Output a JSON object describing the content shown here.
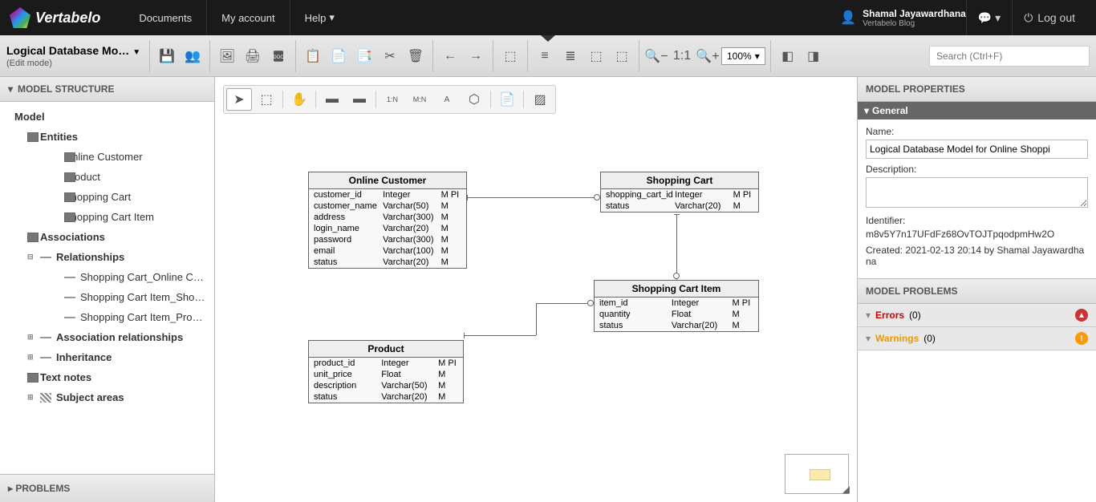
{
  "nav": {
    "brand": "Vertabelo",
    "links": [
      "Documents",
      "My account",
      "Help"
    ],
    "user": {
      "name": "Shamal Jayawardhana",
      "sub": "Vertabelo Blog"
    },
    "logout": "Log out"
  },
  "titlebar": {
    "title": "Logical Database Mo…",
    "mode": "(Edit mode)",
    "zoom": "100%",
    "search_placeholder": "Search (Ctrl+F)"
  },
  "left_panel": {
    "header": "MODEL STRUCTURE",
    "root": "Model",
    "entities_label": "Entities",
    "entities": [
      "Online Customer",
      "Product",
      "Shopping Cart",
      "Shopping Cart Item"
    ],
    "associations_label": "Associations",
    "relationships_label": "Relationships",
    "relationships": [
      "Shopping Cart_Online C…",
      "Shopping Cart Item_Sho…",
      "Shopping Cart Item_Pro…"
    ],
    "assoc_rel_label": "Association relationships",
    "inheritance_label": "Inheritance",
    "textnotes_label": "Text notes",
    "subjectareas_label": "Subject areas",
    "problems_header": "PROBLEMS"
  },
  "entities": {
    "online_customer": {
      "title": "Online Customer",
      "rows": [
        {
          "name": "customer_id",
          "type": "Integer",
          "flags": "M PI"
        },
        {
          "name": "customer_name",
          "type": "Varchar(50)",
          "flags": "M"
        },
        {
          "name": "address",
          "type": "Varchar(300)",
          "flags": "M"
        },
        {
          "name": "login_name",
          "type": "Varchar(20)",
          "flags": "M"
        },
        {
          "name": "password",
          "type": "Varchar(300)",
          "flags": "M"
        },
        {
          "name": "email",
          "type": "Varchar(100)",
          "flags": "M"
        },
        {
          "name": "status",
          "type": "Varchar(20)",
          "flags": "M"
        }
      ]
    },
    "shopping_cart": {
      "title": "Shopping Cart",
      "rows": [
        {
          "name": "shopping_cart_id",
          "type": "Integer",
          "flags": "M PI"
        },
        {
          "name": "status",
          "type": "Varchar(20)",
          "flags": "M"
        }
      ]
    },
    "shopping_cart_item": {
      "title": "Shopping Cart Item",
      "rows": [
        {
          "name": "item_id",
          "type": "Integer",
          "flags": "M PI"
        },
        {
          "name": "quantity",
          "type": "Float",
          "flags": "M"
        },
        {
          "name": "status",
          "type": "Varchar(20)",
          "flags": "M"
        }
      ]
    },
    "product": {
      "title": "Product",
      "rows": [
        {
          "name": "product_id",
          "type": "Integer",
          "flags": "M PI"
        },
        {
          "name": "unit_price",
          "type": "Float",
          "flags": "M"
        },
        {
          "name": "description",
          "type": "Varchar(50)",
          "flags": "M"
        },
        {
          "name": "status",
          "type": "Varchar(20)",
          "flags": "M"
        }
      ]
    }
  },
  "right_panel": {
    "header": "MODEL PROPERTIES",
    "general": "General",
    "name_label": "Name:",
    "name_value": "Logical Database Model for Online Shoppi",
    "desc_label": "Description:",
    "desc_value": "",
    "identifier_label": "Identifier:",
    "identifier_value": "m8v5Y7n17UFdFz68OvTOJTpqodpmHw2O",
    "created": "Created: 2021-02-13 20:14 by Shamal Jayawardhana",
    "problems_header": "MODEL PROBLEMS",
    "errors_label": "Errors",
    "errors_count": "(0)",
    "warnings_label": "Warnings",
    "warnings_count": "(0)"
  }
}
